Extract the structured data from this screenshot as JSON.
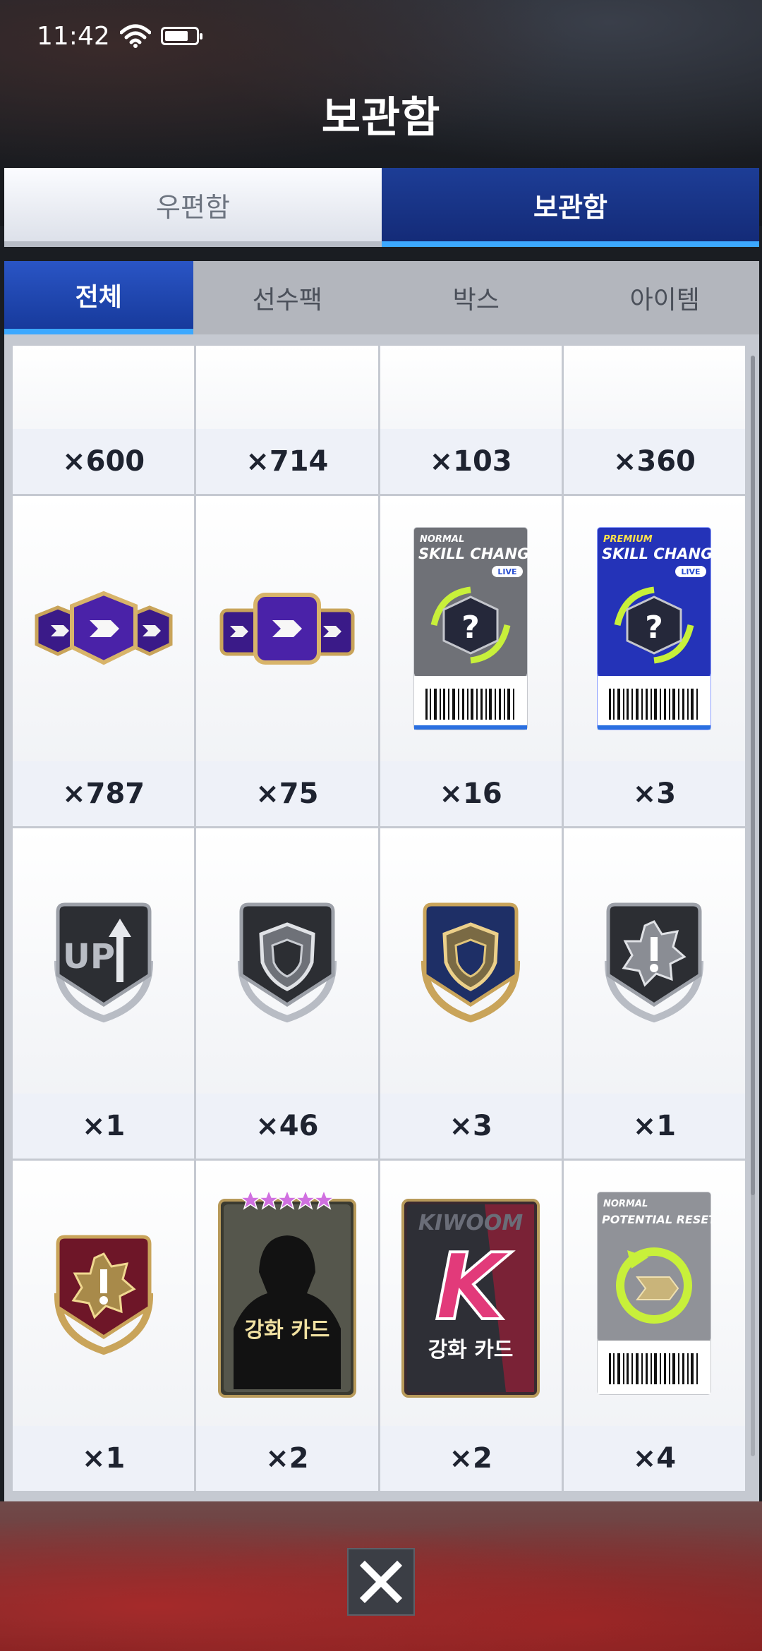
{
  "status_bar": {
    "time": "11:42",
    "wifi_icon": "wifi-icon",
    "battery_icon": "battery-icon"
  },
  "header": {
    "title": "보관함"
  },
  "main_tabs": [
    {
      "label": "우편함",
      "active": false
    },
    {
      "label": "보관함",
      "active": true
    }
  ],
  "sub_tabs": [
    {
      "label": "전체",
      "active": true
    },
    {
      "label": "선수팩",
      "active": false
    },
    {
      "label": "박스",
      "active": false
    },
    {
      "label": "아이템",
      "active": false
    }
  ],
  "items": [
    {
      "count": "×600"
    },
    {
      "count": "×714"
    },
    {
      "count": "×103"
    },
    {
      "count": "×360"
    },
    {
      "icon": "purple-triple-hex-token-icon",
      "count": "×787"
    },
    {
      "icon": "purple-triple-hex-token-icon",
      "count": "×75"
    },
    {
      "icon": "normal-skill-change-ticket-icon",
      "count": "×16",
      "ticket": {
        "grade": "NORMAL",
        "title": "SKILL CHANGE",
        "tag": "LIVE"
      }
    },
    {
      "icon": "premium-skill-change-ticket-icon",
      "count": "×3",
      "ticket": {
        "grade": "PREMIUM",
        "title": "SKILL CHANGE",
        "tag": "LIVE"
      }
    },
    {
      "icon": "up-arrow-badge-icon",
      "count": "×1",
      "badge_text": "UP"
    },
    {
      "icon": "silver-shield-badge-icon",
      "count": "×46"
    },
    {
      "icon": "gold-shield-badge-icon",
      "count": "×3"
    },
    {
      "icon": "silver-alert-badge-icon",
      "count": "×1"
    },
    {
      "icon": "red-alert-badge-icon",
      "count": "×1"
    },
    {
      "icon": "player-enhance-card-icon",
      "count": "×2",
      "card_label": "강화 카드"
    },
    {
      "icon": "kiwoom-enhance-card-icon",
      "count": "×2",
      "card_label": "강화 카드",
      "team_text": "KIWOOM",
      "team_logo": "K"
    },
    {
      "icon": "potential-reset-ticket-icon",
      "count": "×4",
      "ticket": {
        "grade": "NORMAL",
        "title": "POTENTIAL RESET"
      }
    }
  ],
  "colors": {
    "accent_blue": "#1d3d96",
    "tab_highlight": "#3ca8ff",
    "premium_blue": "#2a3fd0"
  },
  "close_button": {
    "icon": "close-icon"
  }
}
